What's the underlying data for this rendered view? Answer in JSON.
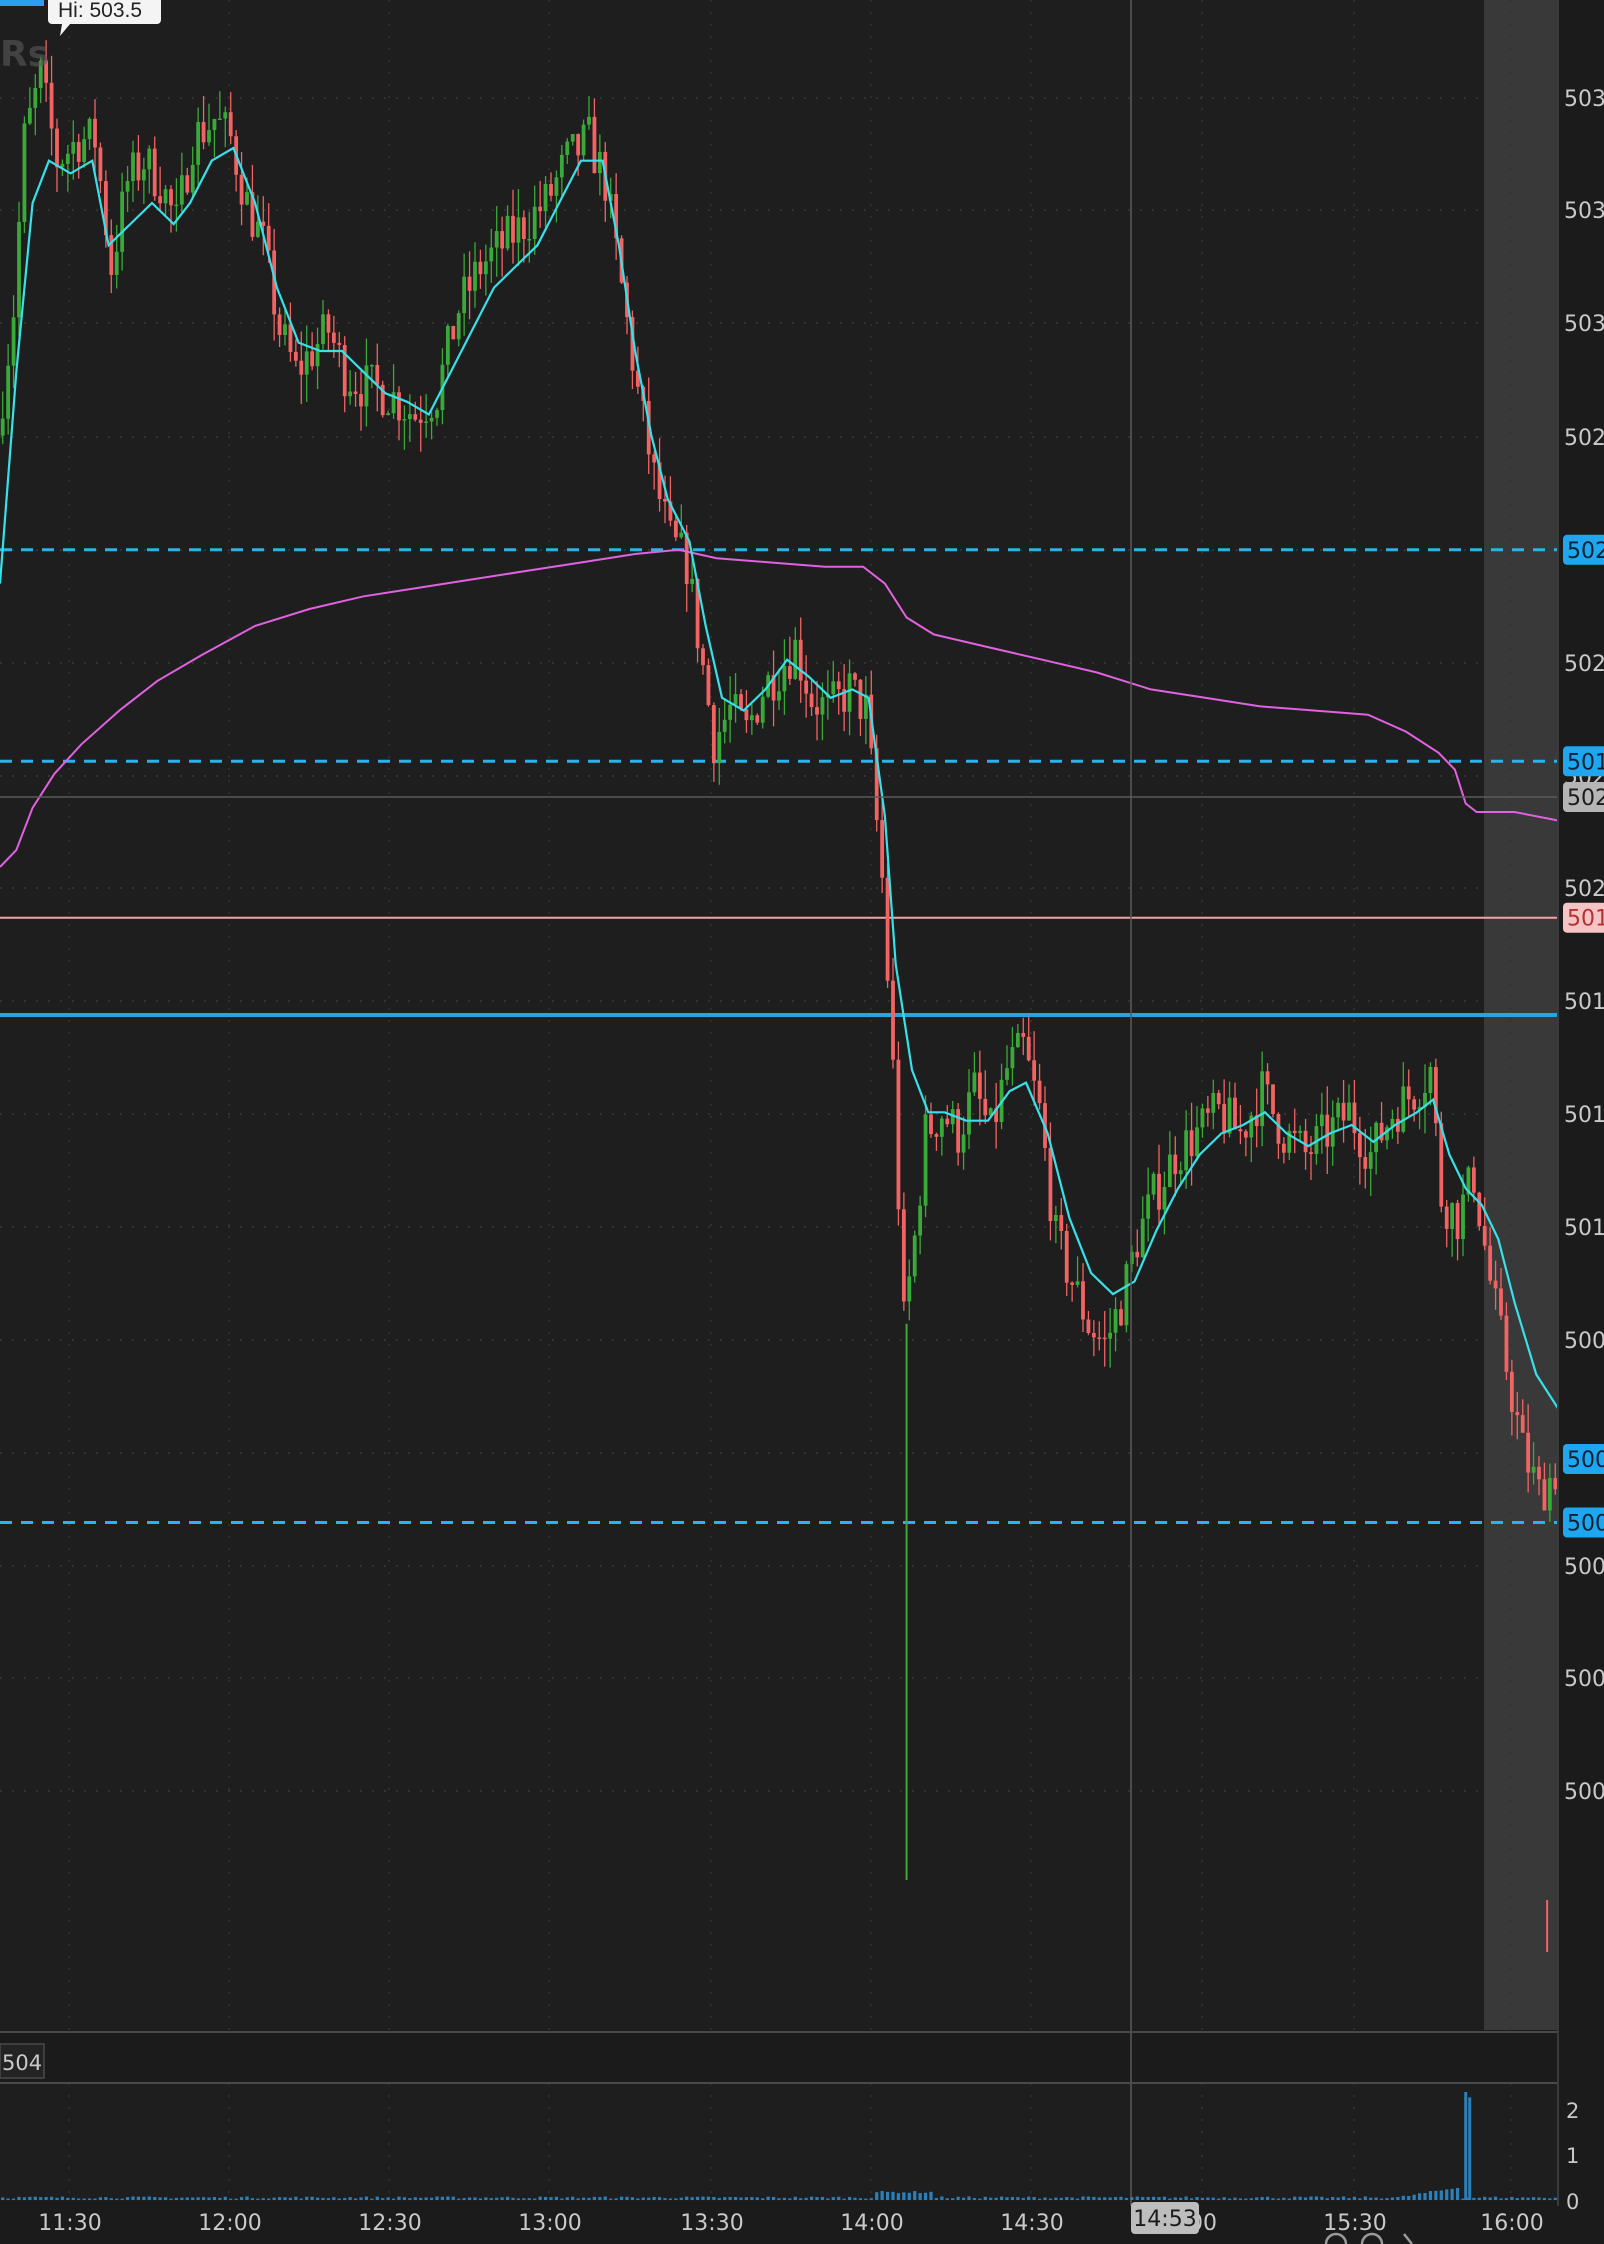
{
  "hi_label": "Hi: 503.5",
  "price_labels": [
    "503",
    "503",
    "503",
    "502",
    "502",
    "502",
    "502",
    "502",
    "501",
    "501",
    "501",
    "500",
    "500",
    "500",
    "500",
    "500"
  ],
  "volume_labels": [
    "2",
    "1",
    "0"
  ],
  "time_labels": [
    "11:30",
    "12:00",
    "12:30",
    "13:00",
    "13:30",
    "14:00",
    "14:30",
    "00",
    "15:30",
    "16:00"
  ],
  "crosshair_time": "14:53",
  "volume_study_value": "504",
  "price_level_badges": [
    {
      "text": "502",
      "style": "blue"
    },
    {
      "text": "502",
      "style": "gray"
    },
    {
      "text": "501",
      "style": "blue"
    },
    {
      "text": "501",
      "style": "pink"
    },
    {
      "text": "500",
      "style": "blue"
    },
    {
      "text": "500",
      "style": "blue"
    }
  ],
  "colors": {
    "background": "#1b1b1b",
    "up_candle": "#3aa93a",
    "down_candle": "#f26363",
    "ema_line": "#39e0e8",
    "vwap_line": "#e062e0",
    "level_dashed": "#2ab3ea",
    "level_solid": "#22a6e6",
    "level_pink": "#f2a3a3",
    "afterhours_shade": "#3a3a3a",
    "volume_bar": "#2c7fb8"
  },
  "chart_data": {
    "type": "candlestick",
    "session_x": [
      "11:23",
      "16:10"
    ],
    "ylim": [
      499.8,
      503.55
    ],
    "levels_dashed": [
      502.33,
      501.83,
      500.03
    ],
    "level_pink": 501.46,
    "level_solid": 501.23,
    "crosshair": {
      "time": "14:53",
      "price": 502.2
    },
    "price_path": [
      [
        "11:23",
        502.6
      ],
      [
        "11:26",
        502.9
      ],
      [
        "11:28",
        503.3
      ],
      [
        "11:31",
        503.45
      ],
      [
        "11:34",
        503.25
      ],
      [
        "11:38",
        503.3
      ],
      [
        "11:41",
        503.3
      ],
      [
        "11:44",
        503.0
      ],
      [
        "11:47",
        503.2
      ],
      [
        "11:50",
        503.25
      ],
      [
        "11:53",
        503.2
      ],
      [
        "11:56",
        503.1
      ],
      [
        "11:59",
        503.3
      ],
      [
        "12:03",
        503.35
      ],
      [
        "12:06",
        503.3
      ],
      [
        "12:09",
        503.15
      ],
      [
        "12:12",
        503.05
      ],
      [
        "12:15",
        502.85
      ],
      [
        "12:18",
        502.75
      ],
      [
        "12:21",
        502.8
      ],
      [
        "12:24",
        502.85
      ],
      [
        "12:27",
        502.75
      ],
      [
        "12:30",
        502.72
      ],
      [
        "12:35",
        502.7
      ],
      [
        "12:40",
        502.65
      ],
      [
        "12:44",
        502.7
      ],
      [
        "12:48",
        502.9
      ],
      [
        "12:52",
        503.0
      ],
      [
        "12:56",
        503.05
      ],
      [
        "13:00",
        503.1
      ],
      [
        "13:04",
        503.15
      ],
      [
        "13:08",
        503.25
      ],
      [
        "13:12",
        503.3
      ],
      [
        "13:15",
        503.2
      ],
      [
        "13:18",
        502.95
      ],
      [
        "13:21",
        502.7
      ],
      [
        "13:24",
        502.5
      ],
      [
        "13:27",
        502.35
      ],
      [
        "13:30",
        502.3
      ],
      [
        "13:33",
        502.05
      ],
      [
        "13:35",
        501.88
      ],
      [
        "13:38",
        501.95
      ],
      [
        "13:41",
        501.9
      ],
      [
        "13:44",
        502.0
      ],
      [
        "13:47",
        502.05
      ],
      [
        "13:50",
        502.1
      ],
      [
        "13:53",
        501.98
      ],
      [
        "13:56",
        501.95
      ],
      [
        "14:00",
        502.0
      ],
      [
        "14:03",
        501.95
      ],
      [
        "14:06",
        501.55
      ],
      [
        "14:08",
        501.1
      ],
      [
        "14:10",
        500.5
      ],
      [
        "14:12",
        500.7
      ],
      [
        "14:14",
        500.95
      ],
      [
        "14:17",
        501.0
      ],
      [
        "14:20",
        500.95
      ],
      [
        "14:23",
        501.05
      ],
      [
        "14:26",
        500.95
      ],
      [
        "14:29",
        501.1
      ],
      [
        "14:32",
        501.15
      ],
      [
        "14:35",
        501.0
      ],
      [
        "14:38",
        500.7
      ],
      [
        "14:41",
        500.6
      ],
      [
        "14:44",
        500.5
      ],
      [
        "14:47",
        500.45
      ],
      [
        "14:50",
        500.55
      ],
      [
        "14:53",
        500.7
      ],
      [
        "14:56",
        500.8
      ],
      [
        "15:00",
        500.9
      ],
      [
        "15:04",
        500.95
      ],
      [
        "15:08",
        501.0
      ],
      [
        "15:12",
        500.95
      ],
      [
        "15:16",
        501.05
      ],
      [
        "15:20",
        500.95
      ],
      [
        "15:24",
        500.9
      ],
      [
        "15:28",
        500.95
      ],
      [
        "15:32",
        501.0
      ],
      [
        "15:36",
        500.9
      ],
      [
        "15:40",
        501.0
      ],
      [
        "15:44",
        501.05
      ],
      [
        "15:47",
        501.1
      ],
      [
        "15:49",
        500.8
      ],
      [
        "15:52",
        500.75
      ],
      [
        "15:55",
        500.85
      ],
      [
        "15:58",
        500.6
      ],
      [
        "16:01",
        500.4
      ],
      [
        "16:04",
        500.2
      ],
      [
        "16:07",
        500.1
      ],
      [
        "16:10",
        500.15
      ]
    ],
    "ema": [
      [
        "11:23",
        502.25
      ],
      [
        "11:26",
        502.75
      ],
      [
        "11:29",
        503.15
      ],
      [
        "11:32",
        503.25
      ],
      [
        "11:36",
        503.22
      ],
      [
        "11:40",
        503.25
      ],
      [
        "11:43",
        503.05
      ],
      [
        "11:47",
        503.1
      ],
      [
        "11:51",
        503.15
      ],
      [
        "11:55",
        503.1
      ],
      [
        "11:58",
        503.15
      ],
      [
        "12:02",
        503.25
      ],
      [
        "12:06",
        503.28
      ],
      [
        "12:10",
        503.15
      ],
      [
        "12:14",
        502.95
      ],
      [
        "12:18",
        502.82
      ],
      [
        "12:22",
        502.8
      ],
      [
        "12:26",
        502.8
      ],
      [
        "12:30",
        502.75
      ],
      [
        "12:34",
        502.7
      ],
      [
        "12:38",
        502.68
      ],
      [
        "12:42",
        502.65
      ],
      [
        "12:46",
        502.75
      ],
      [
        "12:50",
        502.85
      ],
      [
        "12:54",
        502.95
      ],
      [
        "12:58",
        503.0
      ],
      [
        "13:02",
        503.05
      ],
      [
        "13:06",
        503.15
      ],
      [
        "13:10",
        503.25
      ],
      [
        "13:14",
        503.25
      ],
      [
        "13:17",
        503.05
      ],
      [
        "13:20",
        502.8
      ],
      [
        "13:23",
        502.6
      ],
      [
        "13:26",
        502.45
      ],
      [
        "13:30",
        502.35
      ],
      [
        "13:33",
        502.15
      ],
      [
        "13:36",
        501.98
      ],
      [
        "13:40",
        501.95
      ],
      [
        "13:44",
        502.0
      ],
      [
        "13:48",
        502.07
      ],
      [
        "13:52",
        502.03
      ],
      [
        "13:56",
        501.98
      ],
      [
        "14:00",
        502.0
      ],
      [
        "14:03",
        501.98
      ],
      [
        "14:06",
        501.7
      ],
      [
        "14:08",
        501.35
      ],
      [
        "14:11",
        501.1
      ],
      [
        "14:14",
        501.0
      ],
      [
        "14:17",
        501.0
      ],
      [
        "14:21",
        500.98
      ],
      [
        "14:25",
        500.98
      ],
      [
        "14:29",
        501.05
      ],
      [
        "14:32",
        501.07
      ],
      [
        "14:36",
        500.95
      ],
      [
        "14:40",
        500.75
      ],
      [
        "14:44",
        500.62
      ],
      [
        "14:48",
        500.57
      ],
      [
        "14:52",
        500.6
      ],
      [
        "14:56",
        500.72
      ],
      [
        "15:00",
        500.82
      ],
      [
        "15:04",
        500.9
      ],
      [
        "15:08",
        500.95
      ],
      [
        "15:12",
        500.97
      ],
      [
        "15:16",
        501.0
      ],
      [
        "15:20",
        500.95
      ],
      [
        "15:24",
        500.92
      ],
      [
        "15:28",
        500.95
      ],
      [
        "15:32",
        500.97
      ],
      [
        "15:36",
        500.93
      ],
      [
        "15:40",
        500.97
      ],
      [
        "15:44",
        501.0
      ],
      [
        "15:47",
        501.03
      ],
      [
        "15:50",
        500.9
      ],
      [
        "15:53",
        500.82
      ],
      [
        "15:56",
        500.78
      ],
      [
        "15:59",
        500.7
      ],
      [
        "16:02",
        500.55
      ],
      [
        "16:06",
        500.38
      ],
      [
        "16:10",
        500.3
      ]
    ],
    "vwap": [
      [
        "11:23",
        501.58
      ],
      [
        "11:26",
        501.62
      ],
      [
        "11:29",
        501.72
      ],
      [
        "11:33",
        501.8
      ],
      [
        "11:38",
        501.87
      ],
      [
        "11:45",
        501.95
      ],
      [
        "11:52",
        502.02
      ],
      [
        "12:00",
        502.08
      ],
      [
        "12:10",
        502.15
      ],
      [
        "12:20",
        502.19
      ],
      [
        "12:30",
        502.22
      ],
      [
        "12:40",
        502.24
      ],
      [
        "12:50",
        502.26
      ],
      [
        "13:00",
        502.28
      ],
      [
        "13:10",
        502.3
      ],
      [
        "13:20",
        502.32
      ],
      [
        "13:28",
        502.33
      ],
      [
        "13:35",
        502.31
      ],
      [
        "13:45",
        502.3
      ],
      [
        "13:55",
        502.29
      ],
      [
        "14:02",
        502.29
      ],
      [
        "14:06",
        502.25
      ],
      [
        "14:10",
        502.17
      ],
      [
        "14:15",
        502.13
      ],
      [
        "14:25",
        502.1
      ],
      [
        "14:35",
        502.07
      ],
      [
        "14:45",
        502.04
      ],
      [
        "14:55",
        502.0
      ],
      [
        "15:05",
        501.98
      ],
      [
        "15:15",
        501.96
      ],
      [
        "15:25",
        501.95
      ],
      [
        "15:35",
        501.94
      ],
      [
        "15:42",
        501.9
      ],
      [
        "15:48",
        501.85
      ],
      [
        "15:51",
        501.81
      ],
      [
        "15:53",
        501.73
      ],
      [
        "15:55",
        501.71
      ],
      [
        "16:02",
        501.71
      ],
      [
        "16:10",
        501.69
      ]
    ],
    "volume_ylim": [
      0,
      2.6
    ],
    "volume_spike": {
      "time": "15:53",
      "value": 2.4
    }
  }
}
